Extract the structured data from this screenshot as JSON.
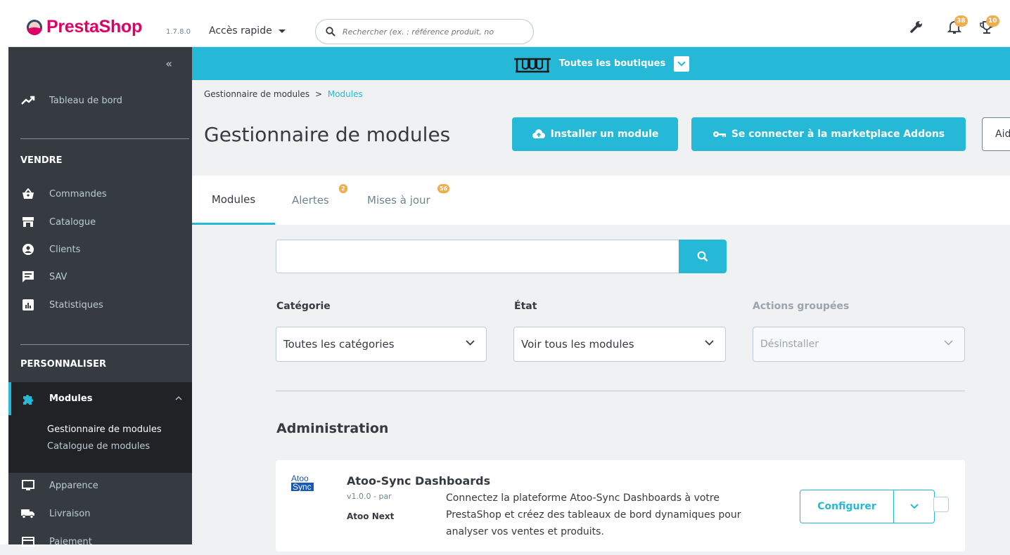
{
  "header": {
    "logo_text": "PrestaShop",
    "version": "1.7.8.0",
    "quick_access": "Accès rapide",
    "search_placeholder": "Rechercher (ex. : référence produit, no",
    "notifications_count": "38",
    "trophy_count": "10"
  },
  "shop_bar": {
    "label": "Toutes les boutiques",
    "color": "#25b9d7"
  },
  "sidebar": {
    "dashboard": "Tableau de bord",
    "section_sell": "VENDRE",
    "sell_items": [
      "Commandes",
      "Catalogue",
      "Clients",
      "SAV",
      "Statistiques"
    ],
    "section_customize": "PERSONNALISER",
    "modules": "Modules",
    "modules_sub": [
      "Gestionnaire de modules",
      "Catalogue de modules"
    ],
    "customize_items": [
      "Apparence",
      "Livraison",
      "Paiement"
    ]
  },
  "breadcrumb": {
    "parent": "Gestionnaire de modules",
    "separator": ">",
    "current": "Modules"
  },
  "page": {
    "title": "Gestionnaire de modules",
    "install_button": "Installer un module",
    "connect_button": "Se connecter à la marketplace Addons",
    "help_button": "Aide"
  },
  "tabs": {
    "modules": "Modules",
    "alerts": "Alertes",
    "alerts_badge": "2",
    "updates": "Mises à jour",
    "updates_badge": "56"
  },
  "filters": {
    "search_value": "",
    "category_label": "Catégorie",
    "category_value": "Toutes les catégories",
    "state_label": "État",
    "state_value": "Voir tous les modules",
    "bulk_label": "Actions groupées",
    "bulk_value": "Désinstaller"
  },
  "section": {
    "title": "Administration"
  },
  "module": {
    "logo_line1": "Atoo",
    "logo_line2": "Sync",
    "name": "Atoo-Sync Dashboards",
    "version": "v1.0.0 - par",
    "author": "Atoo Next",
    "description": "Connectez la plateforme Atoo-Sync Dashboards à votre PrestaShop et créez des tableaux de bord dynamiques pour analyser vos ventes et produits.",
    "configure_button": "Configurer"
  }
}
